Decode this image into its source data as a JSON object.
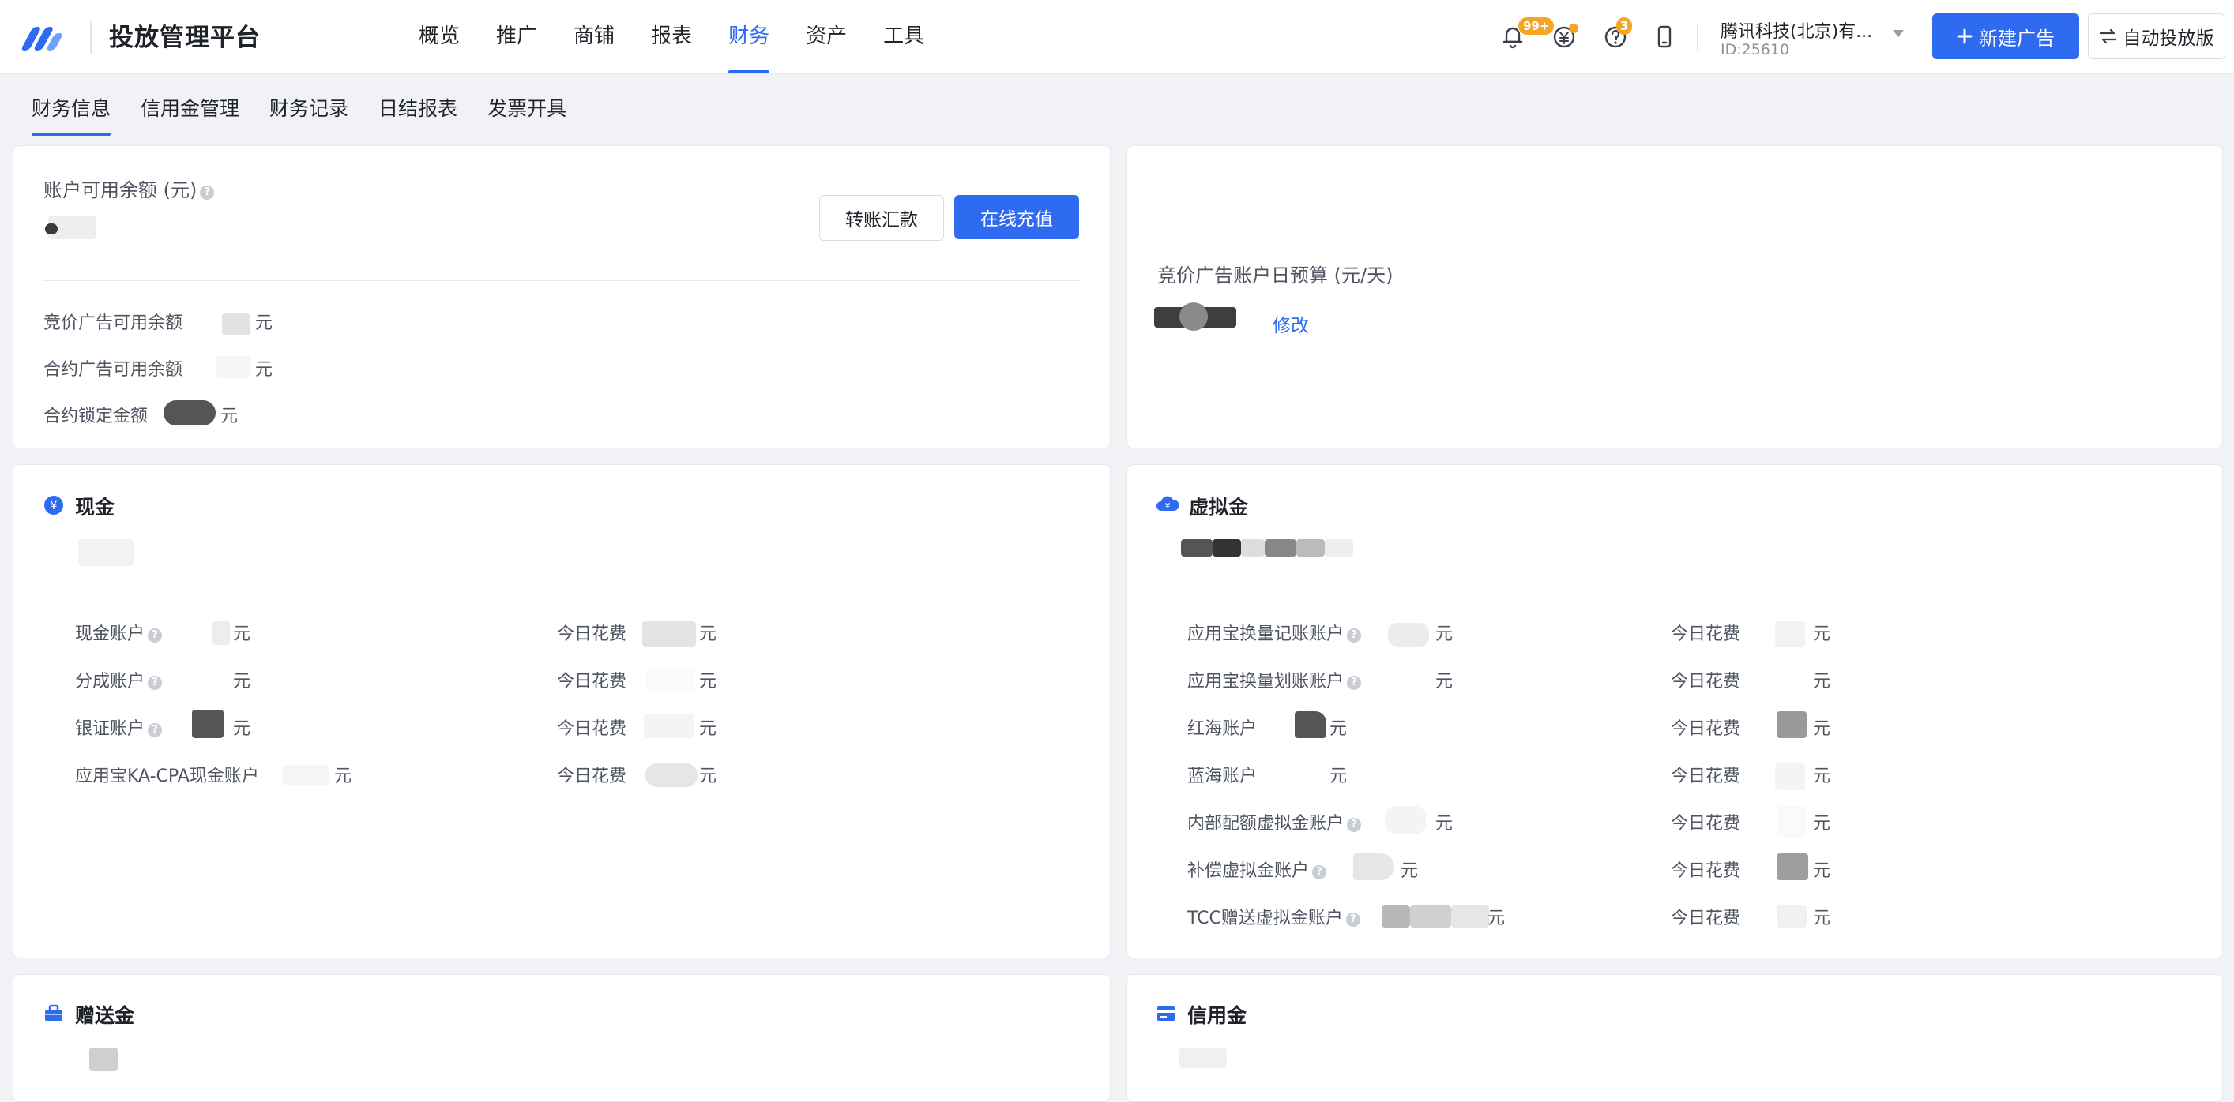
{
  "app": {
    "title": "投放管理平台",
    "nav": [
      "概览",
      "推广",
      "商铺",
      "报表",
      "财务",
      "资产",
      "工具"
    ],
    "nav_active": "财务",
    "notifications_badge": "99+",
    "help_badge": "3",
    "account_name": "腾讯科技(北京)有...",
    "account_id": "ID:25610",
    "new_ad_button": "新建广告",
    "auto_delivery_button": "自动投放版"
  },
  "subtabs": {
    "items": [
      "财务信息",
      "信用金管理",
      "财务记录",
      "日结报表",
      "发票开具"
    ],
    "active": "财务信息"
  },
  "balance_card": {
    "title": "账户可用余额 (元)",
    "transfer_button": "转账汇款",
    "recharge_button": "在线充值",
    "rows": [
      {
        "label": "竞价广告可用余额",
        "unit": "元"
      },
      {
        "label": "合约广告可用余额",
        "unit": "元"
      },
      {
        "label": "合约锁定金额",
        "unit": "元"
      }
    ]
  },
  "budget_card": {
    "title": "竞价广告账户日预算 (元/天)",
    "edit_link": "修改"
  },
  "cash_card": {
    "title": "现金",
    "spend_label": "今日花费",
    "unit": "元",
    "rows": [
      {
        "label": "现金账户",
        "help": true
      },
      {
        "label": "分成账户",
        "help": true
      },
      {
        "label": "银证账户",
        "help": true
      },
      {
        "label": "应用宝KA-CPA现金账户",
        "help": false
      }
    ]
  },
  "virtual_card": {
    "title": "虚拟金",
    "spend_label": "今日花费",
    "unit": "元",
    "rows": [
      {
        "label": "应用宝换量记账账户",
        "help": true
      },
      {
        "label": "应用宝换量划账账户",
        "help": true
      },
      {
        "label": "红海账户",
        "help": false
      },
      {
        "label": "蓝海账户",
        "help": false
      },
      {
        "label": "内部配额虚拟金账户",
        "help": true
      },
      {
        "label": "补偿虚拟金账户",
        "help": true
      },
      {
        "label": "TCC赠送虚拟金账户",
        "help": true
      }
    ]
  },
  "gift_card": {
    "title": "赠送金"
  },
  "credit_card": {
    "title": "信用金"
  },
  "colors": {
    "primary": "#2f6bf0",
    "badge": "#f5a623",
    "page_bg": "#f1f2f5"
  },
  "icons": [
    "bell-icon",
    "coin-icon",
    "help-icon",
    "phone-icon",
    "plus-icon",
    "switch-icon",
    "yen-circle-icon",
    "cloud-icon",
    "briefcase-icon",
    "card-icon"
  ]
}
